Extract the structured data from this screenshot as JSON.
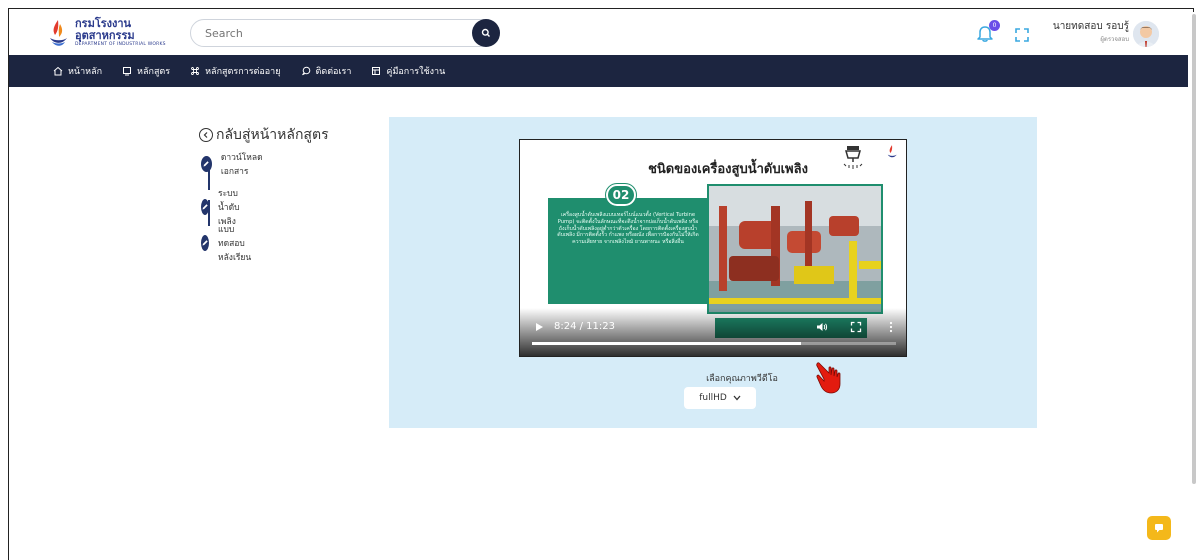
{
  "header": {
    "logo_th": "กรมโรงงานอุตสาหกรรม",
    "logo_en": "DEPARTMENT OF INDUSTRIAL WORKS",
    "search_placeholder": "Search",
    "notification_count": "0",
    "user_name": "นายทดสอบ รอบรู้",
    "user_role": "ผู้ตรวจสอบ"
  },
  "nav": {
    "items": [
      {
        "label": "หน้าหลัก",
        "icon": "home-icon"
      },
      {
        "label": "หลักสูตร",
        "icon": "monitor-icon"
      },
      {
        "label": "หลักสูตรการต่ออายุ",
        "icon": "command-icon"
      },
      {
        "label": "ติดต่อเรา",
        "icon": "chat-icon"
      },
      {
        "label": "คู่มือการใช้งาน",
        "icon": "manual-icon"
      }
    ]
  },
  "sidebar": {
    "back_label": "กลับสู่หน้าหลักสูตร",
    "steps": [
      {
        "label": "ดาวน์โหลดเอกสาร"
      },
      {
        "label": "ระบบน้ำดับเพลิง"
      },
      {
        "label": "แบบทดสอบหลังเรียน"
      }
    ]
  },
  "video": {
    "slide_title": "ชนิดของเครื่องสูบน้ำดับเพลิง",
    "slide_number": "02",
    "slide_text": "เครื่องสูบน้ำดับเพลิงแบบเทอร์ไบน์แนวตั้ง (Vertical Turbine Pump) จะติดตั้งในลักษณะที่จะดึงน้ำจากบ่อเก็บน้ำดับเพลิง หรือถังเก็บน้ำดับเพลิงอยู่ต่ำกว่าตัวเครื่อง โดยการติดตั้งเครื่องสูบน้ำดับเพลิง มีการติดตั้งรั้ว กำแพง หรือผนัง เพื่อการป้องกันไม่ให้เกิดความเสียหาย จากเพลิงไหม้ ยานพาหนะ หรือสิ่งอื่น",
    "time": "8:24 / 11:23",
    "progress": 0.74,
    "icons": [
      "play-icon",
      "volume-icon",
      "fullscreen-icon",
      "more-icon"
    ]
  },
  "quality": {
    "label": "เลือกคุณภาพวีดีโอ",
    "selected": "fullHD"
  },
  "colors": {
    "nav_bg": "#1c2540",
    "panel_bg": "#d6ecf8",
    "slide_green": "#1f8e6e",
    "accent_yellow": "#f4b81a"
  }
}
